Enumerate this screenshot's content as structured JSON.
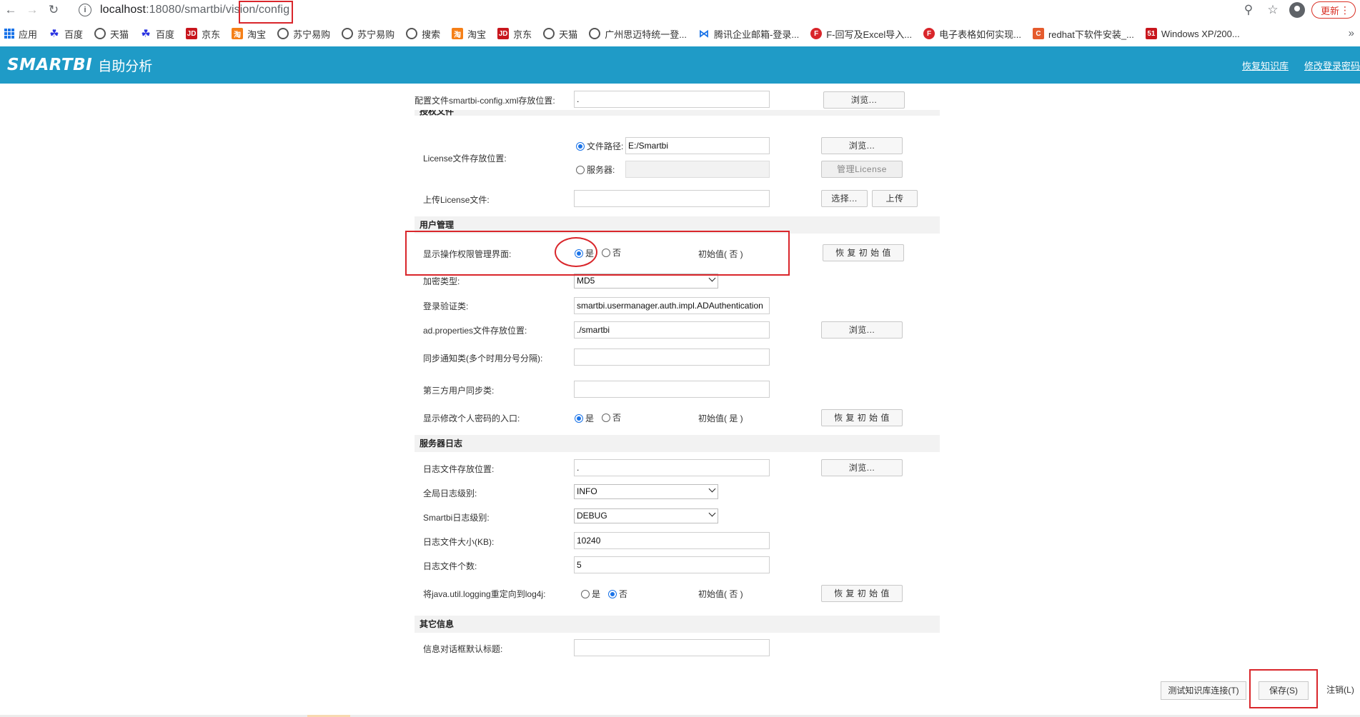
{
  "browser": {
    "url_host": "localhost",
    "url_path": ":18080/smartbi/vision/config",
    "update_label": "更新",
    "bookmarks": [
      {
        "label": "应用",
        "icon": "apps-grid-icon"
      },
      {
        "label": "百度",
        "icon": "baidu-paw-icon"
      },
      {
        "label": "天猫",
        "icon": "globe-icon"
      },
      {
        "label": "百度",
        "icon": "baidu-paw-icon"
      },
      {
        "label": "京东",
        "icon": "jd-icon"
      },
      {
        "label": "淘宝",
        "icon": "taobao-icon"
      },
      {
        "label": "苏宁易购",
        "icon": "globe-icon"
      },
      {
        "label": "苏宁易购",
        "icon": "globe-icon"
      },
      {
        "label": "搜索",
        "icon": "globe-icon"
      },
      {
        "label": "淘宝",
        "icon": "taobao-icon"
      },
      {
        "label": "京东",
        "icon": "jd-icon"
      },
      {
        "label": "天猫",
        "icon": "globe-icon"
      },
      {
        "label": "广州思迈特统一登...",
        "icon": "globe-icon"
      },
      {
        "label": "腾讯企业邮箱-登录...",
        "icon": "mail-icon"
      },
      {
        "label": "F-回写及Excel导入...",
        "icon": "f-icon"
      },
      {
        "label": "电子表格如何实现...",
        "icon": "f-icon"
      },
      {
        "label": "redhat下软件安装_...",
        "icon": "c-icon"
      },
      {
        "label": "Windows XP/200...",
        "icon": "51-icon"
      }
    ]
  },
  "header": {
    "logo": "SMARTBI",
    "subtitle": "自助分析",
    "links": [
      "恢复知识库",
      "修改登录密码"
    ]
  },
  "form": {
    "config_path_label": "配置文件smartbi-config.xml存放位置:",
    "config_path_value": ".",
    "browse": "浏览...",
    "license_section": "授权文件",
    "license_label": "License文件存放位置:",
    "file_path_radio": "文件路径:",
    "file_path_value": "E:/Smartbi",
    "server_radio": "服务器:",
    "manage_license": "管理License",
    "upload_license_label": "上传License文件:",
    "choose": "选择...",
    "upload": "上传",
    "user_section": "用户管理",
    "show_perm_label": "显示操作权限管理界面:",
    "yes": "是",
    "no": "否",
    "initial_no": "初始值( 否 )",
    "initial_yes": "初始值( 是 )",
    "restore": "恢 复 初 始 值",
    "encrypt_label": "加密类型:",
    "encrypt_value": "MD5",
    "login_class_label": "登录验证类:",
    "login_class_value": "smartbi.usermanager.auth.impl.ADAuthentication",
    "ad_props_label": "ad.properties文件存放位置:",
    "ad_props_value": "./smartbi",
    "sync_notify_label": "同步通知类(多个时用分号分隔):",
    "third_party_label": "第三方用户同步类:",
    "show_pwd_label": "显示修改个人密码的入口:",
    "server_log_section": "服务器日志",
    "log_path_label": "日志文件存放位置:",
    "log_path_value": ".",
    "global_level_label": "全局日志级别:",
    "global_level_value": "INFO",
    "smartbi_level_label": "Smartbi日志级别:",
    "smartbi_level_value": "DEBUG",
    "log_size_label": "日志文件大小(KB):",
    "log_size_value": "10240",
    "log_count_label": "日志文件个数:",
    "log_count_value": "5",
    "redirect_label": "将java.util.logging重定向到log4j:",
    "other_section": "其它信息",
    "dialog_title_label": "信息对话框默认标题:"
  },
  "footer": {
    "test_conn": "测试知识库连接(T)",
    "save": "保存(S)",
    "logout": "注销(L)"
  },
  "colors": {
    "header": "#1f9bc7",
    "highlight": "#d9262b",
    "radio": "#1a73e8"
  }
}
